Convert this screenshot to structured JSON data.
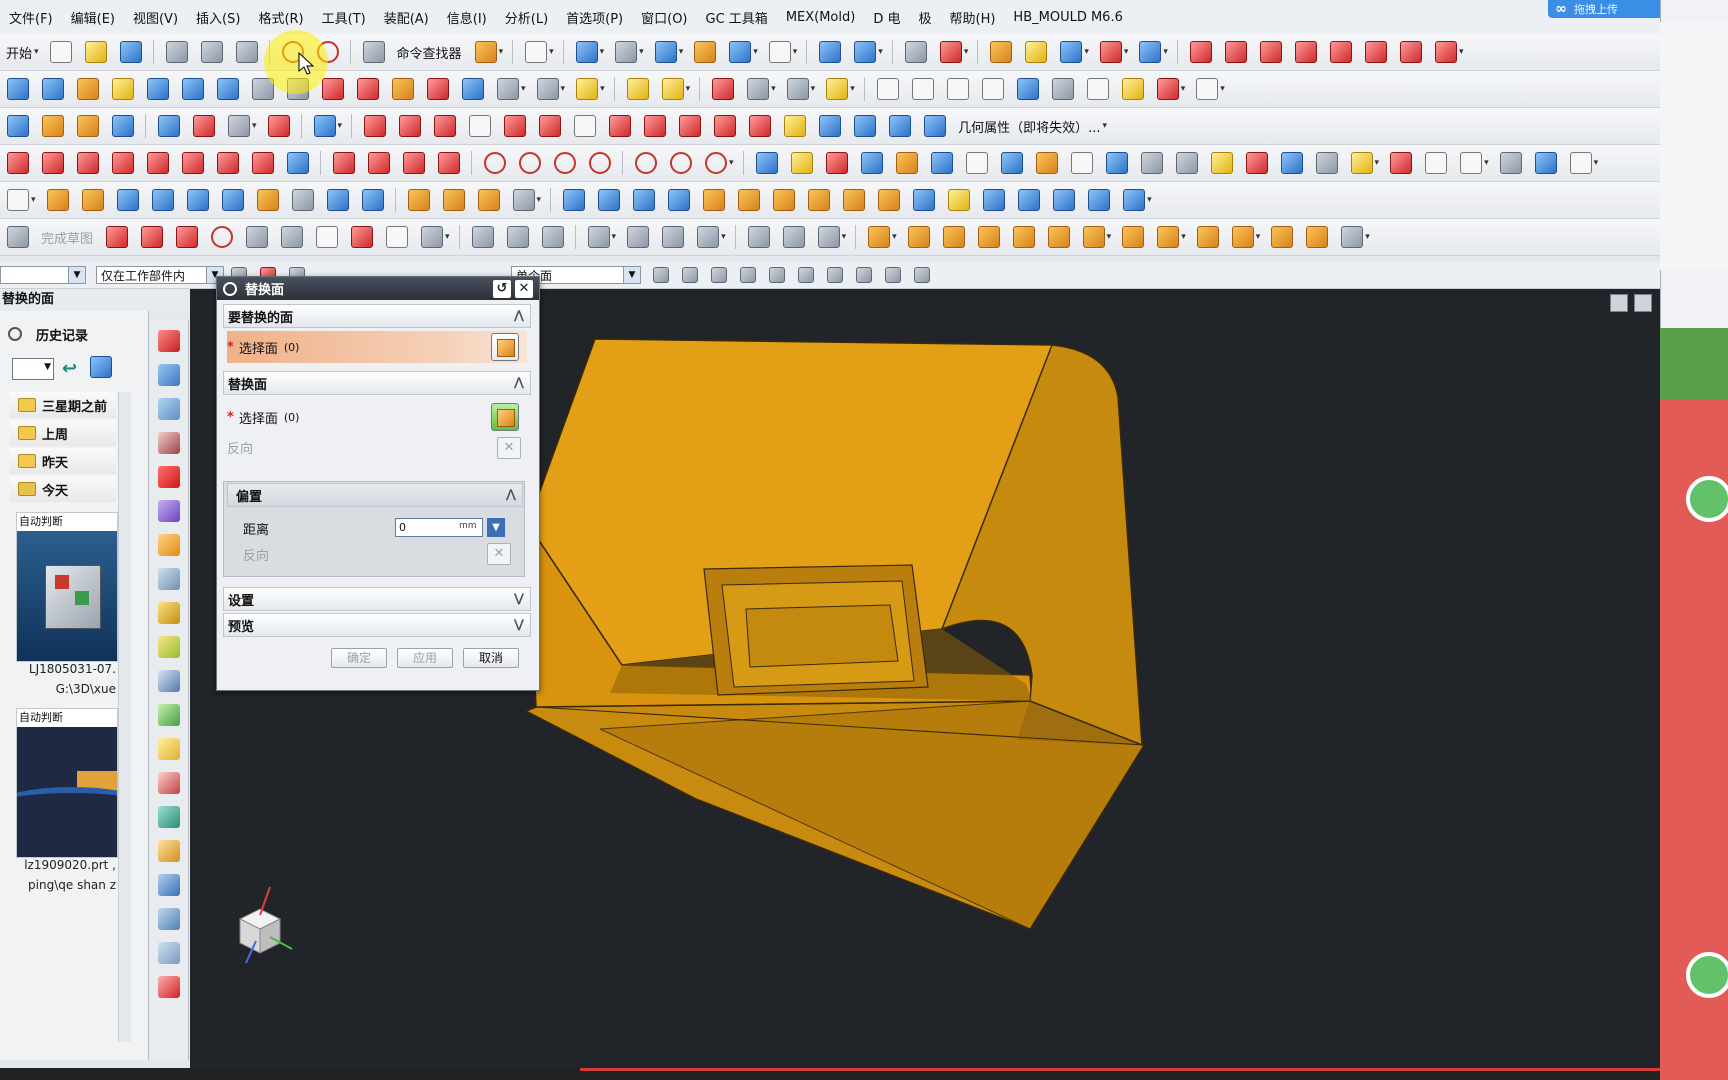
{
  "menu": [
    "文件(F)",
    "编辑(E)",
    "视图(V)",
    "插入(S)",
    "格式(R)",
    "工具(T)",
    "装配(A)",
    "信息(I)",
    "分析(L)",
    "首选项(P)",
    "窗口(O)",
    "GC 工具箱",
    "MEX(Mold)",
    "D 电",
    "极",
    "帮助(H)",
    "HB_MOULD M6.6"
  ],
  "upload_badge": "拖拽上传",
  "toolbar1": {
    "start": "开始",
    "cmd_finder": "命令查找器"
  },
  "toolbar3": {
    "geom_props": "几何属性（即将失效）..."
  },
  "toolbar6": {
    "finish_sketch": "完成草图"
  },
  "selection_bar": {
    "filter": "仅在工作部件内",
    "face_type": "单个面"
  },
  "left_panel": {
    "command_title": "替换的面",
    "history_title": "历史记录",
    "folders": [
      "三星期之前",
      "上周",
      "昨天",
      "今天"
    ],
    "thumbs": [
      {
        "caption": "自动判断",
        "name": "LJ1805031-07.",
        "path": "G:\\3D\\xue"
      },
      {
        "caption": "自动判断",
        "name": "lz1909020.prt ,",
        "path": "ping\\qe shan z"
      }
    ]
  },
  "dialog": {
    "title": "替换面",
    "sec_target": "要替换的面",
    "select_face": "选择面",
    "count": "(0)",
    "sec_replace": "替换面",
    "reverse": "反向",
    "sec_offset": "偏置",
    "distance_label": "距离",
    "distance_value": "0",
    "unit": "mm",
    "sec_settings": "设置",
    "sec_preview": "预览",
    "btn_ok": "确定",
    "btn_apply": "应用",
    "btn_cancel": "取消"
  },
  "colors": {
    "model": "#d4900f",
    "viewport_bg": "#212429",
    "accent_red": "#e35b56"
  }
}
